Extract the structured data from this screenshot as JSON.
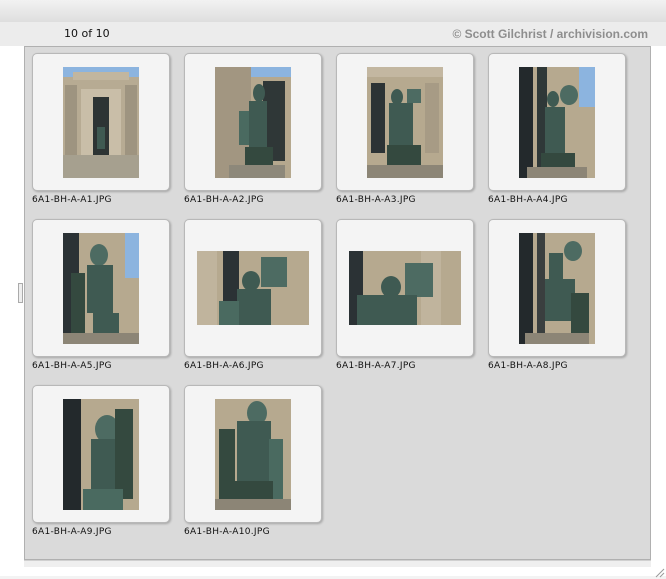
{
  "header": {
    "counter": "10 of 10",
    "copyright": "© Scott Gilchrist / archivision.com"
  },
  "thumbnails": [
    {
      "filename": "6A1-BH-A-A1.JPG",
      "subject": "palais-facade-photo"
    },
    {
      "filename": "6A1-BH-A-A2.JPG",
      "subject": "bronze-statue-photo"
    },
    {
      "filename": "6A1-BH-A-A3.JPG",
      "subject": "bronze-statue-photo"
    },
    {
      "filename": "6A1-BH-A-A4.JPG",
      "subject": "bronze-statue-photo"
    },
    {
      "filename": "6A1-BH-A-A5.JPG",
      "subject": "bronze-statue-photo"
    },
    {
      "filename": "6A1-BH-A-A6.JPG",
      "subject": "bronze-statue-lyre-photo"
    },
    {
      "filename": "6A1-BH-A-A7.JPG",
      "subject": "bronze-statue-lyre-photo"
    },
    {
      "filename": "6A1-BH-A-A8.JPG",
      "subject": "bronze-statue-photo"
    },
    {
      "filename": "6A1-BH-A-A9.JPG",
      "subject": "bronze-statue-detail-photo"
    },
    {
      "filename": "6A1-BH-A-A10.JPG",
      "subject": "bronze-statue-detail-photo"
    }
  ],
  "colors": {
    "panel": "#dadada",
    "cell": "#f4f4f4",
    "bronze": "#3f5a52",
    "stone": "#b7ab93",
    "sky": "#8cb4df"
  }
}
